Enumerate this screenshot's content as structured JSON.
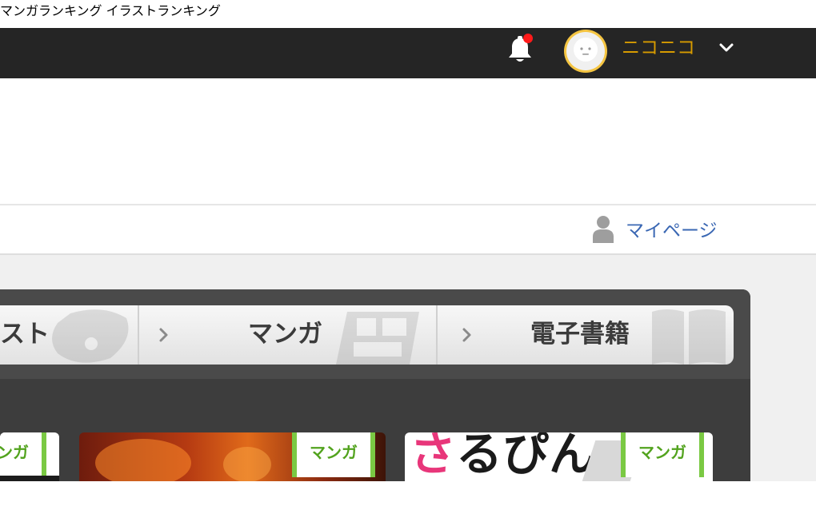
{
  "topbar": {
    "manga_ranking": "マンガランキング",
    "illust_ranking": "イラストランキング",
    "user_name": "ニコニコ",
    "icons": {
      "bell": "bell-icon",
      "avatar": "avatar",
      "chevron": "chevron-down-icon"
    },
    "notification_dot_color": "#ff1a1a"
  },
  "subnav": {
    "mypage_label": "マイページ",
    "mypage_icon": "person-icon"
  },
  "tabs": {
    "items": [
      {
        "label": "スト"
      },
      {
        "label": "マンガ"
      },
      {
        "label": "電子書籍"
      }
    ]
  },
  "cards": {
    "items": [
      {
        "badge": "ンガ"
      },
      {
        "badge": "マンガ"
      },
      {
        "badge": "マンガ",
        "title_pink": "さ",
        "title_rest": "るぴん"
      }
    ]
  },
  "colors": {
    "topbar": "#252525",
    "user_name": "#d79b00",
    "link": "#3a67b3",
    "badge_green": "#7ac943"
  }
}
